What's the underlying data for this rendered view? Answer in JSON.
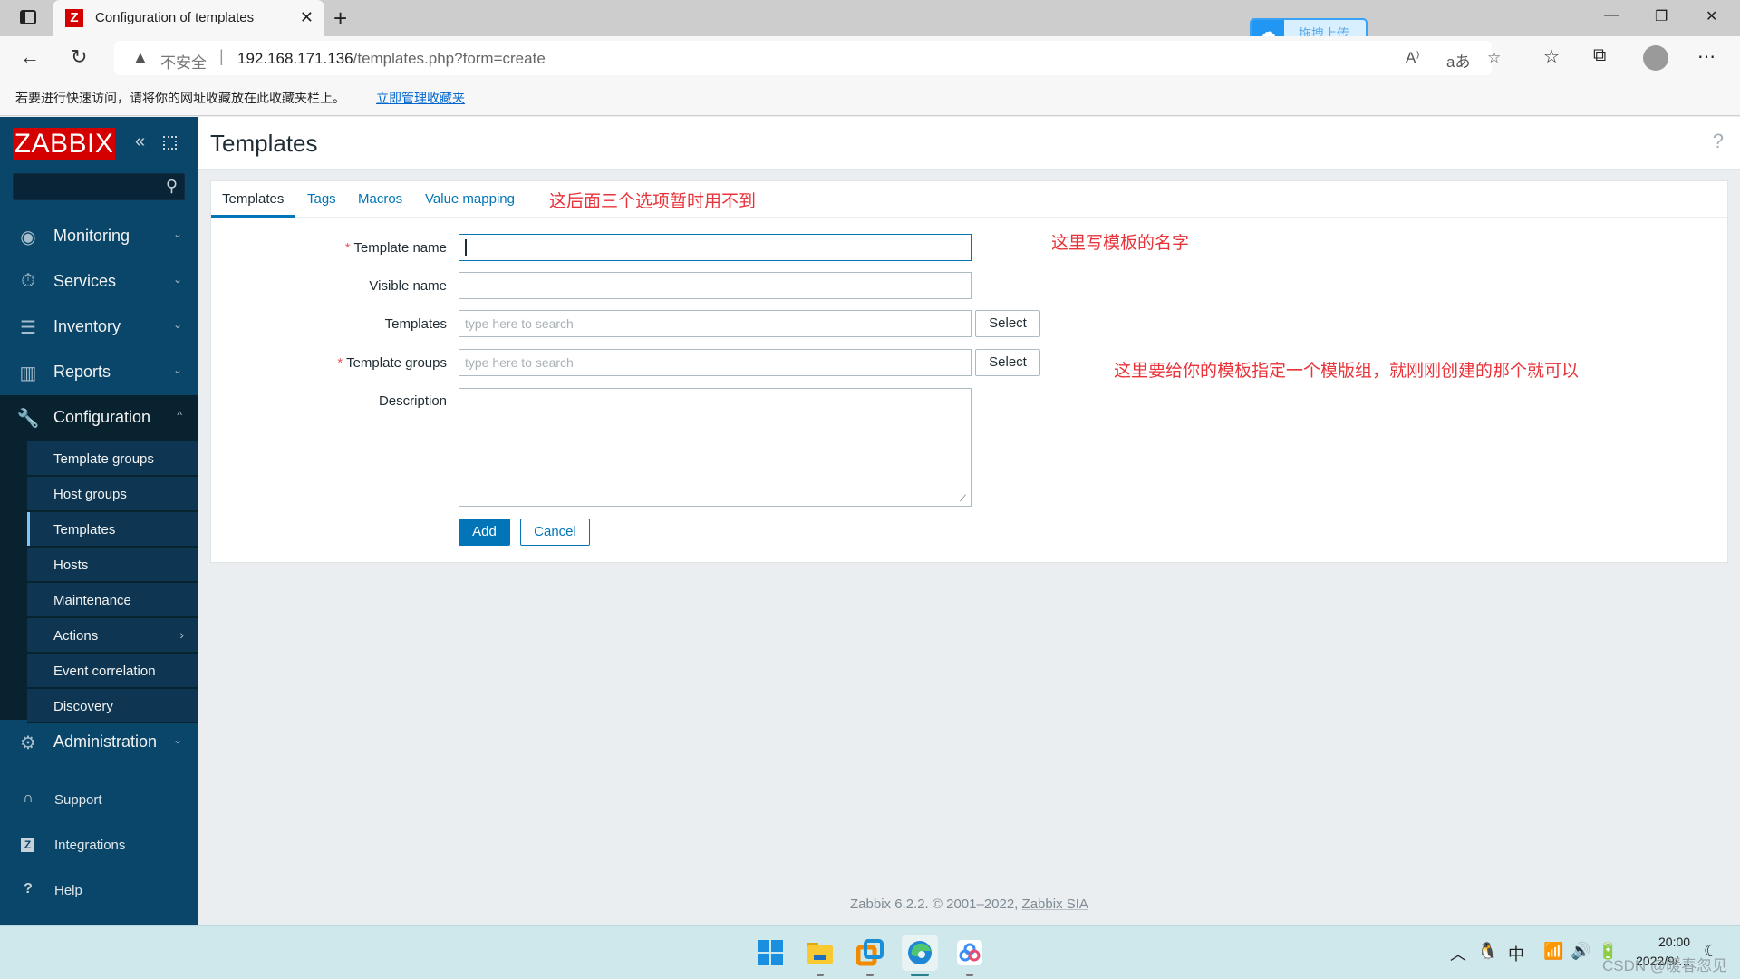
{
  "browser": {
    "tab_title": "Configuration of templates",
    "tab_favicon": "Z",
    "url_insecure_label": "不安全",
    "url_host": "192.168.171.136",
    "url_path": "/templates.php?form=create",
    "upload_widget_label": "拖拽上传",
    "favorites_bar_text": "若要进行快速访问，请将你的网址收藏放在此收藏夹栏上。",
    "favorites_bar_link": "立即管理收藏夹",
    "icons": [
      "back-icon",
      "refresh-icon",
      "warning-icon",
      "read-aloud-icon",
      "translate-icon",
      "add-favorite-icon",
      "favorites-icon",
      "collections-icon",
      "profile-icon",
      "more-icon"
    ]
  },
  "sidebar": {
    "logo": "ZABBIX",
    "search_placeholder": "",
    "menu": [
      {
        "label": "Monitoring",
        "icon": "eye-icon"
      },
      {
        "label": "Services",
        "icon": "stopwatch-icon"
      },
      {
        "label": "Inventory",
        "icon": "list-icon"
      },
      {
        "label": "Reports",
        "icon": "bar-chart-icon"
      },
      {
        "label": "Configuration",
        "icon": "wrench-icon"
      },
      {
        "label": "Administration",
        "icon": "gear-icon"
      }
    ],
    "submenu": [
      {
        "label": "Template groups"
      },
      {
        "label": "Host groups"
      },
      {
        "label": "Templates"
      },
      {
        "label": "Hosts"
      },
      {
        "label": "Maintenance"
      },
      {
        "label": "Actions"
      },
      {
        "label": "Event correlation"
      },
      {
        "label": "Discovery"
      }
    ],
    "footer": [
      {
        "label": "Support",
        "icon": "headset-icon"
      },
      {
        "label": "Integrations",
        "icon": "zabbix-icon"
      },
      {
        "label": "Help",
        "icon": "help-icon"
      }
    ]
  },
  "header": {
    "title": "Templates",
    "help": "?"
  },
  "form": {
    "tabs": [
      "Templates",
      "Tags",
      "Macros",
      "Value mapping"
    ],
    "active_tab": "Templates",
    "fields": {
      "template_name": {
        "label": "Template name",
        "required": "*",
        "value": ""
      },
      "visible_name": {
        "label": "Visible name",
        "value": ""
      },
      "templates": {
        "label": "Templates",
        "placeholder": "type here to search",
        "button": "Select"
      },
      "template_groups": {
        "label": "Template groups",
        "required": "*",
        "placeholder": "type here to search",
        "button": "Select"
      },
      "description": {
        "label": "Description",
        "value": ""
      }
    },
    "add_button": "Add",
    "cancel_button": "Cancel"
  },
  "annotations": {
    "tabs_note": "这后面三个选项暂时用不到",
    "name_note": "这里写模板的名字",
    "group_note": "这里要给你的模板指定一个模版组，就刚刚创建的那个就可以"
  },
  "footer": {
    "text": "Zabbix 6.2.2. © 2001–2022, ",
    "link": "Zabbix SIA"
  },
  "taskbar": {
    "apps": [
      "windows-start-icon",
      "file-explorer-icon",
      "vmware-icon",
      "edge-icon",
      "baidu-netdisk-icon"
    ],
    "tray": {
      "ime": "中",
      "time": "20:00",
      "date": "2022/9/…"
    },
    "watermark": "CSDN @暖春忽见"
  }
}
